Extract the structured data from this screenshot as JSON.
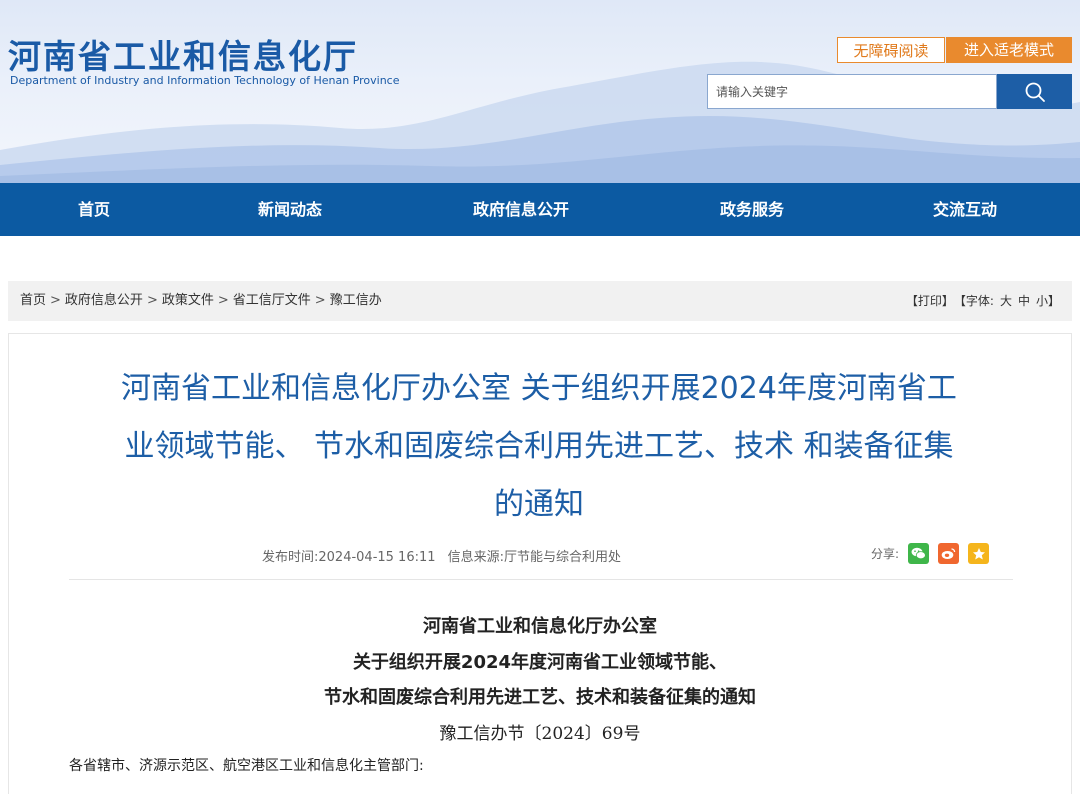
{
  "header": {
    "title_cn": "河南省工业和信息化厅",
    "title_en": "Department of Industry and Information Technology of Henan Province",
    "accessibility_label": "无障碍阅读",
    "elder_mode_label": "进入适老模式",
    "search_placeholder": "请输入关键字"
  },
  "nav": {
    "items": [
      {
        "label": "首页"
      },
      {
        "label": "新闻动态"
      },
      {
        "label": "政府信息公开"
      },
      {
        "label": "政务服务"
      },
      {
        "label": "交流互动"
      }
    ]
  },
  "breadcrumb": {
    "items": [
      "首页",
      "政府信息公开",
      "政策文件",
      "省工信厅文件",
      "豫工信办"
    ],
    "separator": ">"
  },
  "tools": {
    "print": "【打印】",
    "font_label": "【字体:",
    "font_large": "大",
    "font_medium": "中",
    "font_small": "小",
    "font_close": "】"
  },
  "article": {
    "title_lines": [
      "河南省工业和信息化厅办公室 关于组织开展2024年度河南省工",
      "业领域节能、 节水和固废综合利用先进工艺、技术 和装备征集",
      "的通知"
    ],
    "publish_time": "发布时间:2024-04-15 16:11",
    "source": "信息来源:厅节能与综合利用处",
    "share_label": "分享:",
    "doc_heading_lines": [
      "河南省工业和信息化厅办公室",
      "关于组织开展2024年度河南省工业领域节能、",
      "节水和固废综合利用先进工艺、技术和装备征集的通知"
    ],
    "doc_number": "豫工信办节〔2024〕69号",
    "salutation": "各省辖市、济源示范区、航空港区工业和信息化主管部门:"
  },
  "colors": {
    "brand_blue": "#1d5ea6",
    "nav_blue": "#0c5aa2",
    "accent_orange": "#e98a2e",
    "wechat_green": "#3fb64a",
    "weibo_orange": "#f0672f",
    "favorite_yellow": "#f5b51c"
  },
  "icons": {
    "search": "search-icon",
    "share": [
      "wechat-icon",
      "weibo-icon",
      "star-icon"
    ]
  }
}
